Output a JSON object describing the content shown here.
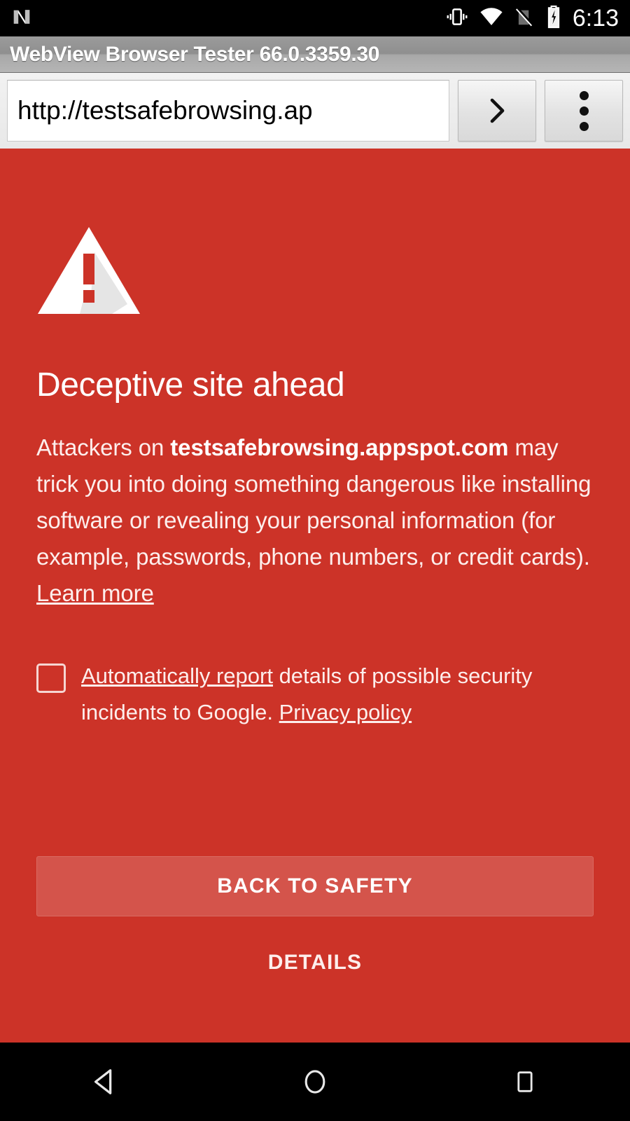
{
  "status_bar": {
    "clock": "6:13",
    "icons": [
      "android-n-logo",
      "vibrate-icon",
      "wifi-icon",
      "no-signal-icon",
      "battery-charging-icon"
    ]
  },
  "title_bar": {
    "title": "WebView Browser Tester 66.0.3359.30"
  },
  "toolbar": {
    "url_value": "http://testsafebrowsing.ap",
    "url_placeholder": "Enter URL",
    "go_label": "›",
    "menu_label": "overflow-menu"
  },
  "interstitial": {
    "heading": "Deceptive site ahead",
    "body_before": "Attackers on ",
    "body_domain": "testsafebrowsing.appspot.com",
    "body_after": " may trick you into doing something dangerous like installing software or revealing your personal information (for example, passwords, phone numbers, or credit cards).",
    "learn_more": "Learn more",
    "optin_link": "Automatically report",
    "optin_text": " details of possible security incidents to Google. ",
    "privacy_policy": "Privacy policy",
    "checkbox_checked": false,
    "primary_button": "BACK TO SAFETY",
    "secondary_button": "DETAILS",
    "colors": {
      "background": "#cc3328",
      "button": "#d4544b",
      "text": "#fdeeec"
    }
  },
  "nav_bar": {
    "back": "back-button",
    "home": "home-button",
    "recents": "recents-button"
  }
}
